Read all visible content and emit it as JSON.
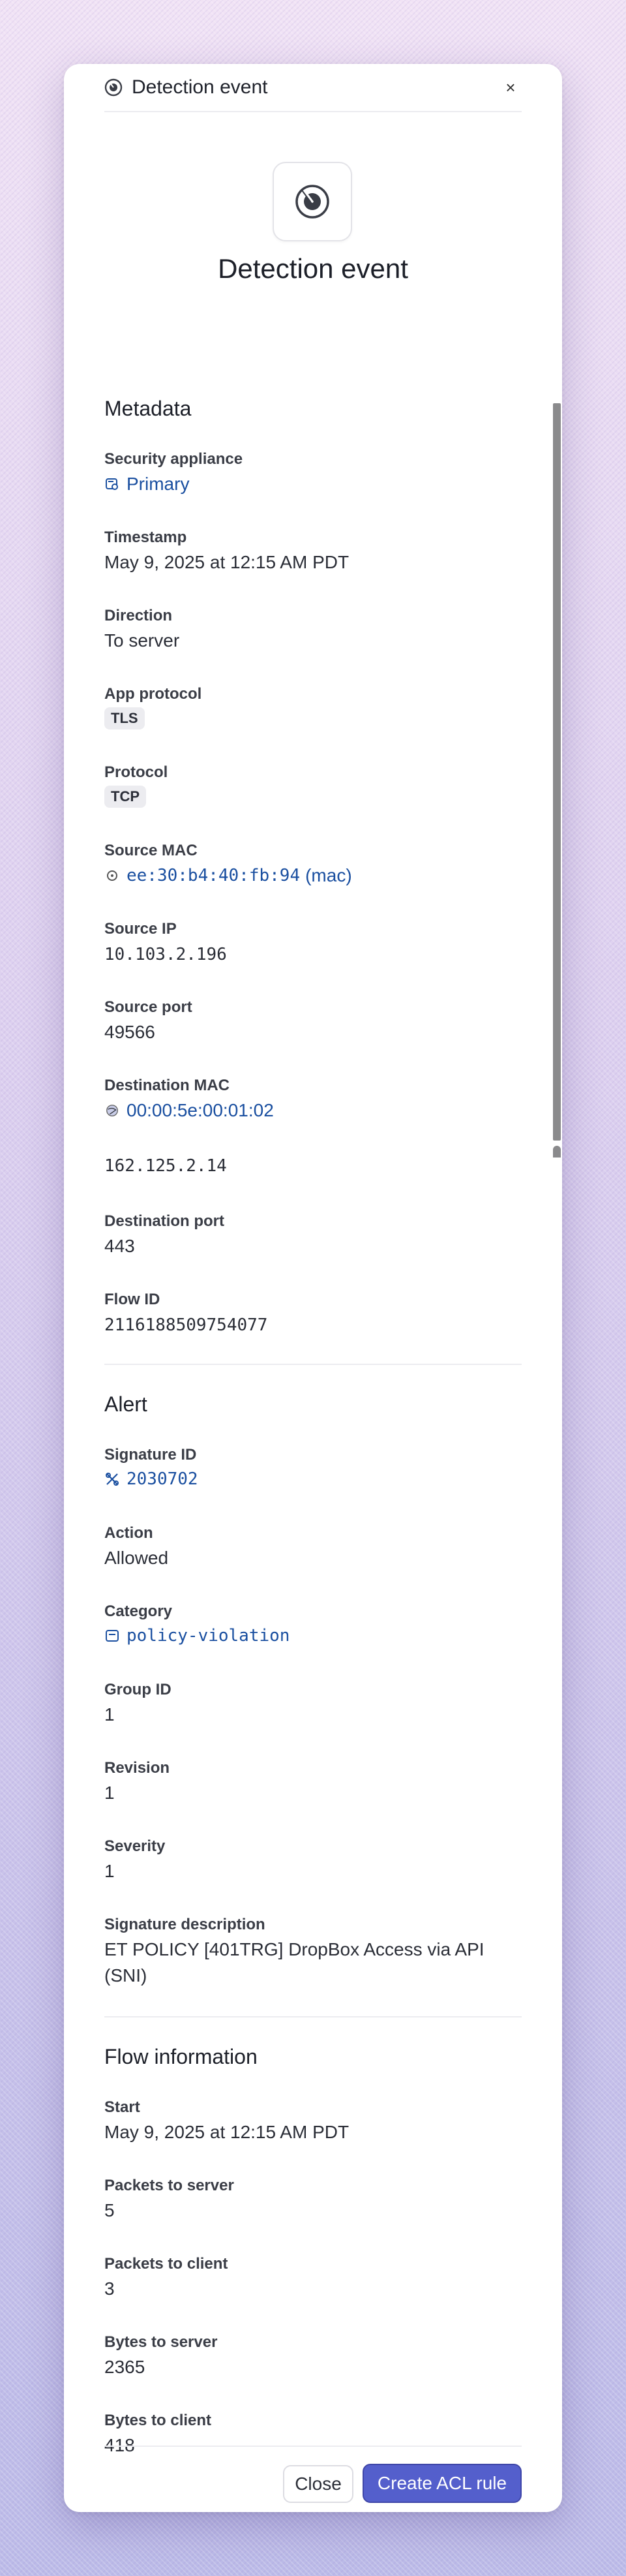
{
  "modal": {
    "header_title": "Detection event",
    "close_symbol": "×",
    "hero_title": "Detection event",
    "header_icon": "radar-icon"
  },
  "metadata": {
    "title": "Metadata",
    "security_appliance": {
      "label": "Security appliance",
      "value": "Primary",
      "icon": "appliance-icon"
    },
    "timestamp": {
      "label": "Timestamp",
      "value": "May 9, 2025 at 12:15 AM PDT"
    },
    "direction": {
      "label": "Direction",
      "value": "To server"
    },
    "app_protocol": {
      "label": "App protocol",
      "value": "TLS"
    },
    "protocol": {
      "label": "Protocol",
      "value": "TCP"
    },
    "source_mac": {
      "label": "Source MAC",
      "value": "ee:30:b4:40:fb:94",
      "suffix": "(mac)",
      "icon": "device-icon"
    },
    "source_ip": {
      "label": "Source IP",
      "value": "10.103.2.196"
    },
    "source_port": {
      "label": "Source port",
      "value": "49566"
    },
    "destination_mac": {
      "label": "Destination MAC",
      "value": "00:00:5e:00:01:02",
      "icon": "globe-icon"
    },
    "destination_ip": {
      "value": "162.125.2.14"
    },
    "destination_port": {
      "label": "Destination port",
      "value": "443"
    },
    "flow_id": {
      "label": "Flow ID",
      "value": "2116188509754077"
    }
  },
  "alert": {
    "title": "Alert",
    "signature_id": {
      "label": "Signature ID",
      "value": "2030702",
      "icon": "signature-icon"
    },
    "action": {
      "label": "Action",
      "value": "Allowed"
    },
    "category": {
      "label": "Category",
      "value": "policy-violation",
      "icon": "category-icon"
    },
    "group_id": {
      "label": "Group ID",
      "value": "1"
    },
    "revision": {
      "label": "Revision",
      "value": "1"
    },
    "severity": {
      "label": "Severity",
      "value": "1"
    },
    "signature_description": {
      "label": "Signature description",
      "value_line1": "ET POLICY [401TRG] DropBox Access via API",
      "value_line2": "(SNI)"
    }
  },
  "flow": {
    "title": "Flow information",
    "start": {
      "label": "Start",
      "value": "May 9, 2025 at 12:15 AM PDT"
    },
    "packets_to_server": {
      "label": "Packets to server",
      "value": "5"
    },
    "packets_to_client": {
      "label": "Packets to client",
      "value": "3"
    },
    "bytes_to_server": {
      "label": "Bytes to server",
      "value": "2365"
    },
    "bytes_to_client": {
      "label": "Bytes to client",
      "value": "418"
    }
  },
  "footer": {
    "close_label": "Close",
    "primary_label": "Create ACL rule"
  },
  "colors": {
    "link": "#1a4fa0",
    "primary_button": "#545fcc"
  }
}
